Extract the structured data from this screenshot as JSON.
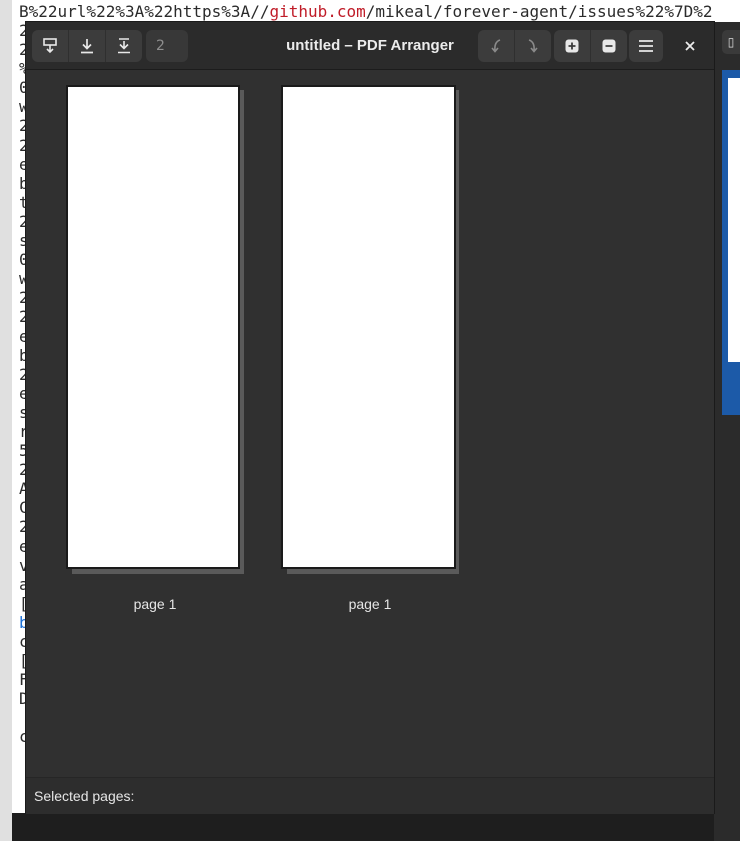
{
  "terminal": {
    "line0_prefix": "B%22url%22%3A%22https%3A//",
    "line0_link": "github.com",
    "line0_suffix": "/mikeal/forever-agent/issues%22%7D%2",
    "column_chars": [
      "2",
      "2",
      "%",
      "0",
      "w",
      "2",
      "2",
      "e",
      "b",
      "t",
      "2",
      "s",
      "0",
      "w",
      "2",
      "2",
      "e",
      "b",
      "2",
      "e",
      "s",
      "r",
      "5",
      "2",
      "A",
      "C",
      "2",
      "e",
      "v",
      "a",
      "[",
      "b",
      "c",
      "[",
      "F",
      "D",
      "",
      "c"
    ]
  },
  "window": {
    "title": "untitled – PDF Arranger",
    "page_entry_placeholder": "2",
    "toolbar": {
      "icons": [
        "import-icon",
        "save-icon",
        "save-as-icon",
        "rotate-left-icon",
        "rotate-right-icon",
        "zoom-in-icon",
        "zoom-out-icon",
        "menu-icon",
        "close-icon"
      ],
      "rotate_disabled": true
    },
    "pages": [
      {
        "label": "page 1"
      },
      {
        "label": "page 1"
      }
    ],
    "status": {
      "selected_label": "Selected pages:"
    }
  },
  "side_window": {
    "accent": "#1c5aa8"
  },
  "colors": {
    "window_bg": "#303030",
    "headerbar_bg": "#2b2b2b",
    "button_bg": "#3c3c3c",
    "text": "#ececec",
    "terminal_link": "#c01c28"
  }
}
